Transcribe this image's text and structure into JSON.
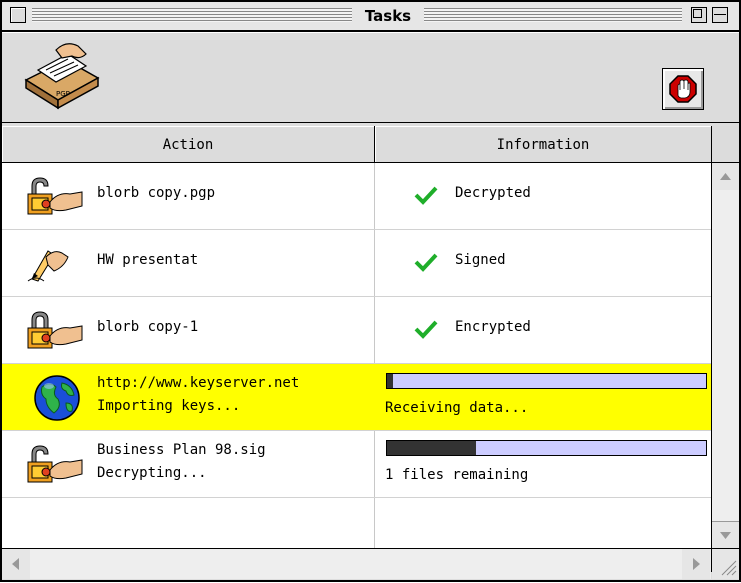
{
  "window": {
    "title": "Tasks"
  },
  "columns": {
    "action": "Action",
    "information": "Information"
  },
  "rows": [
    {
      "icon": "unlock-key-icon",
      "name": "blorb copy.pgp",
      "status": "",
      "info": "Decrypted",
      "state": "done"
    },
    {
      "icon": "pen-sign-icon",
      "name": "HW presentat",
      "status": "",
      "info": "Signed",
      "state": "done"
    },
    {
      "icon": "lock-key-icon",
      "name": "blorb copy-1",
      "status": "",
      "info": "Encrypted",
      "state": "done"
    },
    {
      "icon": "globe-icon",
      "name": "http://www.keyserver.net",
      "status": "Importing keys...",
      "info": "Receiving data...",
      "state": "progress",
      "progress": 0.02,
      "highlight": true
    },
    {
      "icon": "unlock-key-icon",
      "name": "Business Plan 98.sig",
      "status": "Decrypting...",
      "info": "1 files remaining",
      "state": "progress",
      "progress": 0.28,
      "highlight": false
    }
  ],
  "colors": {
    "highlight": "#ffff00",
    "progress_bg": "#ccccff",
    "progress_fill": "#333333",
    "check": "#1fae2a"
  }
}
